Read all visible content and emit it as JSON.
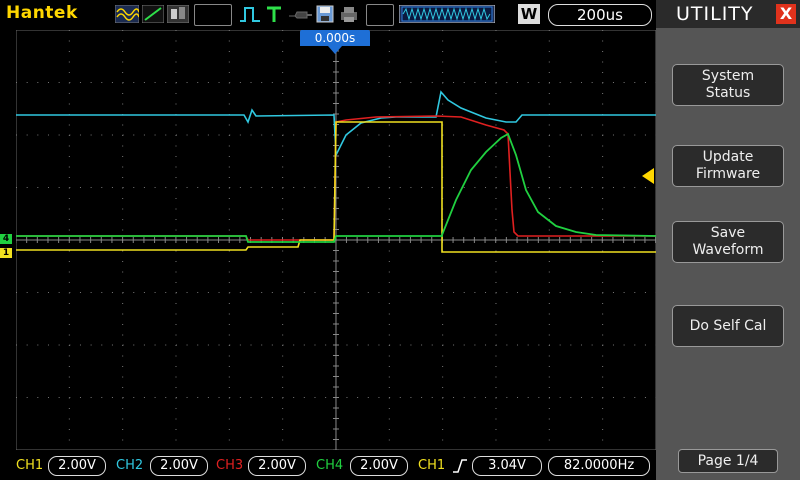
{
  "header": {
    "brand": "Hantek",
    "timebase": "200us",
    "mode_letter": "W",
    "trigger_time": "0.000s"
  },
  "icons": [
    "wave-mode-icon",
    "vector-mode-icon",
    "persist-mode-icon",
    "pulse-icon",
    "trigger-t-icon",
    "probe-icon",
    "save-icon",
    "print-icon",
    "waveform-position-icon"
  ],
  "colors": {
    "ch1": "#f0e020",
    "ch2": "#30c8e0",
    "ch3": "#e02020",
    "ch4": "#20d040",
    "brand": "#ffd700",
    "trigger_marker": "#1e6fd6"
  },
  "channels": [
    {
      "label": "CH1",
      "value": "2.00V",
      "color": "#f0e020"
    },
    {
      "label": "CH2",
      "value": "2.00V",
      "color": "#30c8e0"
    },
    {
      "label": "CH3",
      "value": "2.00V",
      "color": "#e02020"
    },
    {
      "label": "CH4",
      "value": "2.00V",
      "color": "#20d040"
    }
  ],
  "trigger": {
    "source": "CH1",
    "level": "3.04V",
    "frequency": "82.0000Hz"
  },
  "markers": {
    "ch4": "4",
    "ch1": "1"
  },
  "panel": {
    "title": "UTILITY",
    "close": "X",
    "buttons": [
      {
        "line1": "System",
        "line2": "Status"
      },
      {
        "line1": "Update",
        "line2": "Firmware"
      },
      {
        "line1": "Save",
        "line2": "Waveform"
      },
      {
        "line1": "Do Self Cal",
        "line2": ""
      }
    ],
    "page": "Page 1/4"
  }
}
